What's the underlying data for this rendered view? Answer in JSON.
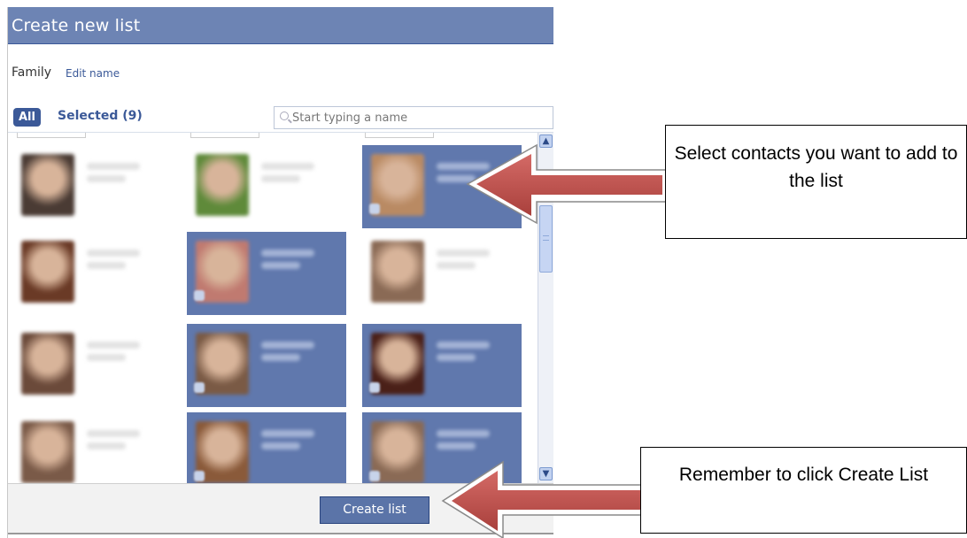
{
  "dialog": {
    "title": "Create new list",
    "list_name": "Family",
    "edit_name_link": "Edit name",
    "tabs": {
      "all": "All",
      "selected": "Selected (9)"
    },
    "search": {
      "placeholder": "Start typing a name"
    },
    "create_button": "Create list"
  },
  "contacts": [
    {
      "selected": false,
      "photo_color": "#4a3b34"
    },
    {
      "selected": false,
      "photo_color": "#5f8a3a"
    },
    {
      "selected": true,
      "photo_color": "#b98a63"
    },
    {
      "selected": false,
      "photo_color": "#6a3a26"
    },
    {
      "selected": true,
      "photo_color": "#c07a70"
    },
    {
      "selected": false,
      "photo_color": "#8a6a55"
    },
    {
      "selected": false,
      "photo_color": "#6b4a3a"
    },
    {
      "selected": true,
      "photo_color": "#7a5a45"
    },
    {
      "selected": true,
      "photo_color": "#4a2018"
    },
    {
      "selected": false,
      "photo_color": "#7a5a48"
    },
    {
      "selected": true,
      "photo_color": "#8a5a3a"
    },
    {
      "selected": true,
      "photo_color": "#8a6a55"
    }
  ],
  "callouts": {
    "select_contacts": "Select contacts you want to add to the list",
    "remember_click": "Remember to click Create List"
  },
  "colors": {
    "facebook_blue": "#3b5998",
    "title_bar": "#6d84b4",
    "selected_tile": "#6078ad",
    "arrow_fill": "#c0504d"
  }
}
